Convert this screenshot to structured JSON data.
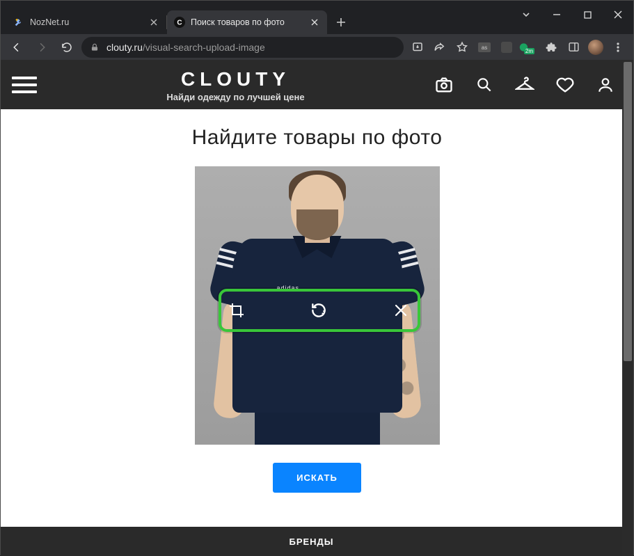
{
  "window": {
    "tabs": [
      {
        "title": "NozNet.ru",
        "active": false
      },
      {
        "title": "Поиск товаров по фото",
        "active": true
      }
    ]
  },
  "addressbar": {
    "host": "clouty.ru",
    "path": "/visual-search-upload-image",
    "ext_badge": "2m"
  },
  "site": {
    "logo": "CLOUTY",
    "tagline": "Найди одежду по лучшей цене"
  },
  "page": {
    "heading": "Найдите товары по фото",
    "search_button": "ИСКАТЬ",
    "brand_logo_on_shirt": "adidas"
  },
  "footer": {
    "brands": "БРЕНДЫ"
  }
}
